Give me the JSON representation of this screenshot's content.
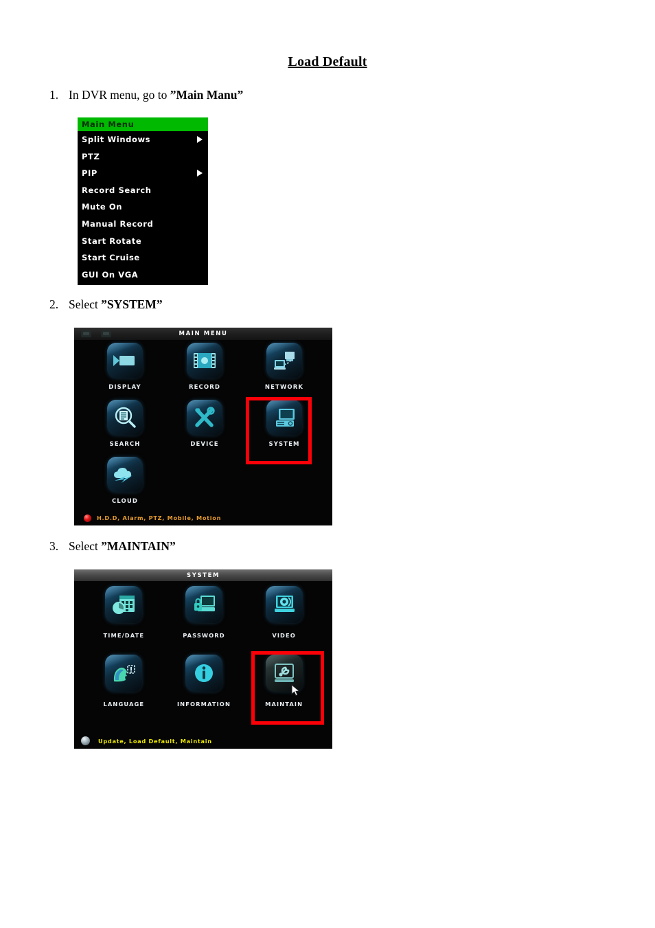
{
  "document": {
    "title": "Load Default",
    "steps": [
      {
        "number": "1.",
        "text_before": "In DVR menu, go to ",
        "emphasis": "”Main Manu”"
      },
      {
        "number": "2.",
        "text_before": "Select ",
        "emphasis": "”SYSTEM”"
      },
      {
        "number": "3.",
        "text_before": "Select ",
        "emphasis": "”MAINTAIN”"
      }
    ]
  },
  "dvr_context_menu": {
    "header": "Main Menu",
    "header_color": "#00b900",
    "items": [
      {
        "label": "Split Windows",
        "submenu_arrow": true
      },
      {
        "label": "PTZ",
        "submenu_arrow": false
      },
      {
        "label": "PIP",
        "submenu_arrow": true
      },
      {
        "label": "Record Search",
        "submenu_arrow": false
      },
      {
        "label": "Mute On",
        "submenu_arrow": false
      },
      {
        "label": "Manual Record",
        "submenu_arrow": false
      },
      {
        "label": "Start Rotate",
        "submenu_arrow": false
      },
      {
        "label": "Start Cruise",
        "submenu_arrow": false
      },
      {
        "label": "GUI On VGA",
        "submenu_arrow": false
      }
    ]
  },
  "main_menu_screen": {
    "title": "MAIN MENU",
    "items": [
      {
        "label": "DISPLAY",
        "icon": "video-camera-icon",
        "selected": false
      },
      {
        "label": "RECORD",
        "icon": "film-strip-icon",
        "selected": false
      },
      {
        "label": "NETWORK",
        "icon": "network-computers-icon",
        "selected": false
      },
      {
        "label": "SEARCH",
        "icon": "magnifier-document-icon",
        "selected": false
      },
      {
        "label": "DEVICE",
        "icon": "wrench-screwdriver-icon",
        "selected": false
      },
      {
        "label": "SYSTEM",
        "icon": "computer-icon",
        "selected": true
      },
      {
        "label": "CLOUD",
        "icon": "cloud-icon",
        "selected": false
      }
    ],
    "status_bar": {
      "icon": "red-sphere-icon",
      "text": "H.D.D, Alarm, PTZ, Mobile, Motion",
      "text_color": "#e49a2c"
    },
    "highlight_color": "#fc0008"
  },
  "system_screen": {
    "title": "SYSTEM",
    "items": [
      {
        "label": "TIME/DATE",
        "icon": "clock-calendar-icon",
        "selected": false
      },
      {
        "label": "PASSWORD",
        "icon": "monitor-lock-icon",
        "selected": false
      },
      {
        "label": "VIDEO",
        "icon": "monitor-lens-icon",
        "selected": false
      },
      {
        "label": "LANGUAGE",
        "icon": "head-speech-icon",
        "selected": false
      },
      {
        "label": "INFORMATION",
        "icon": "info-circle-icon",
        "selected": false
      },
      {
        "label": "MAINTAIN",
        "icon": "wrench-box-icon",
        "selected": true
      }
    ],
    "status_bar": {
      "icon": "gray-sphere-icon",
      "text": "Update, Load Default, Maintain",
      "text_color": "#ece800"
    },
    "highlight_color": "#fc0008",
    "cursor": "mouse-pointer"
  }
}
